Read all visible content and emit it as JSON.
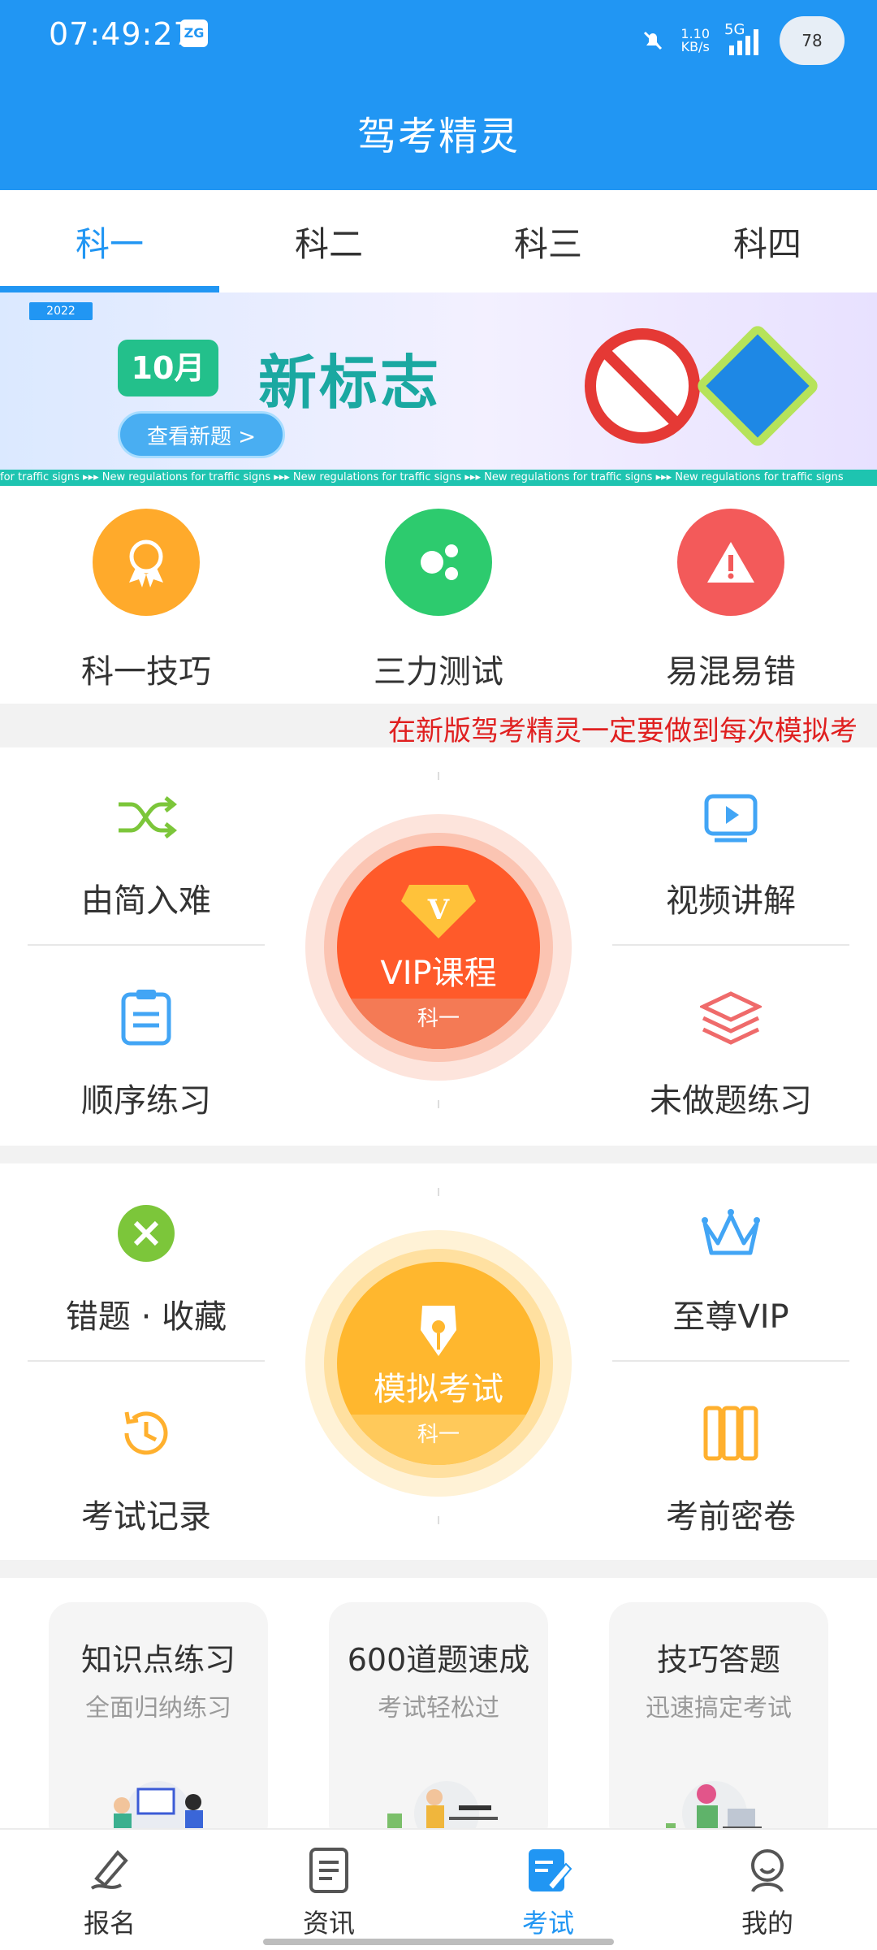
{
  "status_bar": {
    "time": "07:49:27",
    "net_speed": "1.10",
    "net_unit": "KB/s",
    "network": "5G",
    "battery": "78"
  },
  "header": {
    "title": "驾考精灵"
  },
  "tabs": [
    {
      "label": "科一",
      "active": true
    },
    {
      "label": "科二",
      "active": false
    },
    {
      "label": "科三",
      "active": false
    },
    {
      "label": "科四",
      "active": false
    }
  ],
  "banner": {
    "year": "2022",
    "month": "10月",
    "headline": "新标志",
    "button": "查看新题 >",
    "ticker": "for traffic signs  ▸▸▸  New regulations for traffic signs  ▸▸▸  New regulations for traffic signs  ▸▸▸  New regulations for traffic signs  ▸▸▸  New regulations for traffic signs"
  },
  "quick": [
    {
      "label": "科一技巧",
      "color": "#FFAA2B"
    },
    {
      "label": "三力测试",
      "color": "#2DCB6E"
    },
    {
      "label": "易混易错",
      "color": "#F35A5A"
    }
  ],
  "marquee": "在新版驾考精灵一定要做到每次模拟考",
  "section1": {
    "left_top": "由简入难",
    "left_bottom": "顺序练习",
    "right_top": "视频讲解",
    "right_bottom": "未做题练习",
    "center": {
      "badge": "V",
      "title": "VIP课程",
      "sub": "科一"
    }
  },
  "section2": {
    "left_top": "错题 · 收藏",
    "left_bottom": "考试记录",
    "right_top": "至尊VIP",
    "right_bottom": "考前密卷",
    "center": {
      "title": "模拟考试",
      "sub": "科一"
    }
  },
  "cards": [
    {
      "title": "知识点练习",
      "subtitle": "全面归纳练习"
    },
    {
      "title": "600道题速成",
      "subtitle": "考试轻松过"
    },
    {
      "title": "技巧答题",
      "subtitle": "迅速搞定考试"
    }
  ],
  "bottom_nav": [
    {
      "label": "报名",
      "active": false
    },
    {
      "label": "资讯",
      "active": false
    },
    {
      "label": "考试",
      "active": true
    },
    {
      "label": "我的",
      "active": false
    }
  ],
  "colors": {
    "primary": "#2196F3",
    "vip": "#FF5722",
    "exam": "#FFB300"
  }
}
